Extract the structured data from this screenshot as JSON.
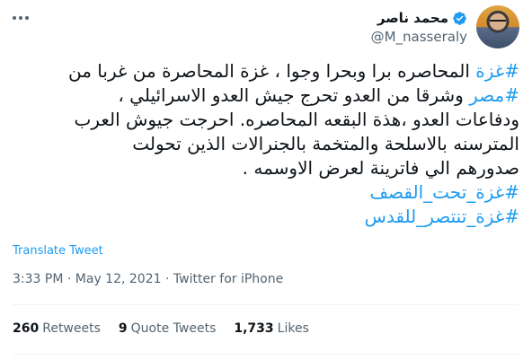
{
  "user": {
    "name": "محمد ناصر",
    "handle": "@M_nasseraly"
  },
  "tweet": {
    "lines": [
      [
        {
          "type": "hashtag",
          "text": "#غزة"
        },
        {
          "type": "text",
          "text": " المحاصره برا وبحرا وجوا ، غزة المحاصرة من غربا من"
        }
      ],
      [
        {
          "type": "hashtag",
          "text": "#مصر"
        },
        {
          "type": "text",
          "text": " وشرقا من العدو  تحرج جيش العدو الاسرائيلي ،"
        }
      ],
      [
        {
          "type": "text",
          "text": "ودفاعات العدو ،هذة البقعه المحاصره. احرجت جيوش العرب"
        }
      ],
      [
        {
          "type": "text",
          "text": "المترسنه بالاسلحة والمتخمة بالجنرالات الذين تحولت"
        }
      ],
      [
        {
          "type": "text",
          "text": "صدورهم الي فاترينة لعرض الاوسمه ."
        }
      ],
      [
        {
          "type": "hashtag",
          "text": "#غزة_تحت_القصف"
        }
      ],
      [
        {
          "type": "hashtag",
          "text": "#غزة_تنتصر_للقدس"
        }
      ]
    ]
  },
  "translate_label": "Translate Tweet",
  "meta": {
    "time": "3:33 PM",
    "separator": "·",
    "date": "May 12, 2021",
    "source": "Twitter for iPhone"
  },
  "stats": {
    "retweets_count": "260",
    "retweets_label": "Retweets",
    "quotes_count": "9",
    "quotes_label": "Quote Tweets",
    "likes_count": "1,733",
    "likes_label": "Likes"
  },
  "colors": {
    "accent": "#1d9bf0",
    "secondary_text": "#536471",
    "divider": "#eff3f4"
  }
}
